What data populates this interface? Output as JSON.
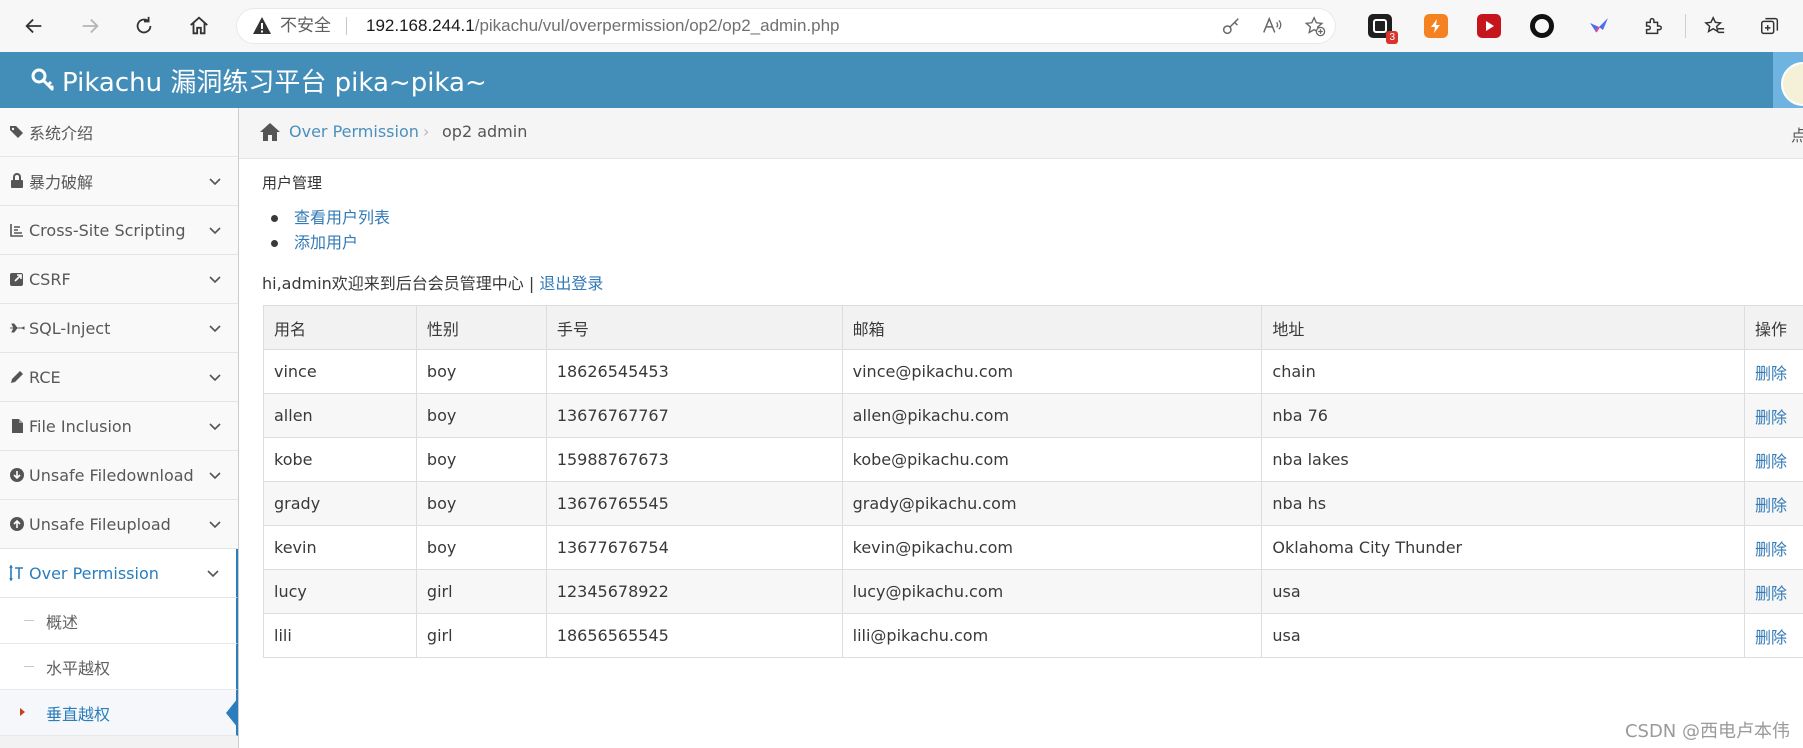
{
  "browser": {
    "insecure_label": "不安全",
    "url_host": "192.168.244.1",
    "url_path": "/pikachu/vul/overpermission/op2/op2_admin.php",
    "extension_badge": "3"
  },
  "app": {
    "title": "Pikachu 漏洞练习平台 pika~pika~"
  },
  "sidebar": {
    "items": [
      {
        "label": "系统介绍"
      },
      {
        "label": "暴力破解"
      },
      {
        "label": "Cross-Site Scripting"
      },
      {
        "label": "CSRF"
      },
      {
        "label": "SQL-Inject"
      },
      {
        "label": "RCE"
      },
      {
        "label": "File Inclusion"
      },
      {
        "label": "Unsafe Filedownload"
      },
      {
        "label": "Unsafe Fileupload"
      },
      {
        "label": "Over Permission"
      }
    ],
    "subitems": [
      {
        "label": "概述"
      },
      {
        "label": "水平越权"
      },
      {
        "label": "垂直越权"
      }
    ]
  },
  "breadcrumb": {
    "parent": "Over Permission",
    "current": "op2 admin",
    "right_text": "点"
  },
  "main": {
    "section_title": "用户管理",
    "links": [
      "查看用户列表",
      "添加用户"
    ],
    "welcome": "hi,admin欢迎来到后台会员管理中心 | ",
    "logout": "退出登录"
  },
  "table": {
    "headers": [
      "用名",
      "性别",
      "手号",
      "邮箱",
      "地址",
      "操作"
    ],
    "rows": [
      [
        "vince",
        "boy",
        "18626545453",
        "vince@pikachu.com",
        "chain",
        "删除"
      ],
      [
        "allen",
        "boy",
        "13676767767",
        "allen@pikachu.com",
        "nba 76",
        "删除"
      ],
      [
        "kobe",
        "boy",
        "15988767673",
        "kobe@pikachu.com",
        "nba lakes",
        "删除"
      ],
      [
        "grady",
        "boy",
        "13676765545",
        "grady@pikachu.com",
        "nba hs",
        "删除"
      ],
      [
        "kevin",
        "boy",
        "13677676754",
        "kevin@pikachu.com",
        "Oklahoma City Thunder",
        "删除"
      ],
      [
        "lucy",
        "girl",
        "12345678922",
        "lucy@pikachu.com",
        "usa",
        "删除"
      ],
      [
        "lili",
        "girl",
        "18656565545",
        "lili@pikachu.com",
        "usa",
        "删除"
      ]
    ]
  },
  "watermark": "CSDN @西电卢本伟",
  "colors": {
    "header": "#438eb9",
    "link": "#337ab7",
    "active": "#2b7dbc"
  }
}
